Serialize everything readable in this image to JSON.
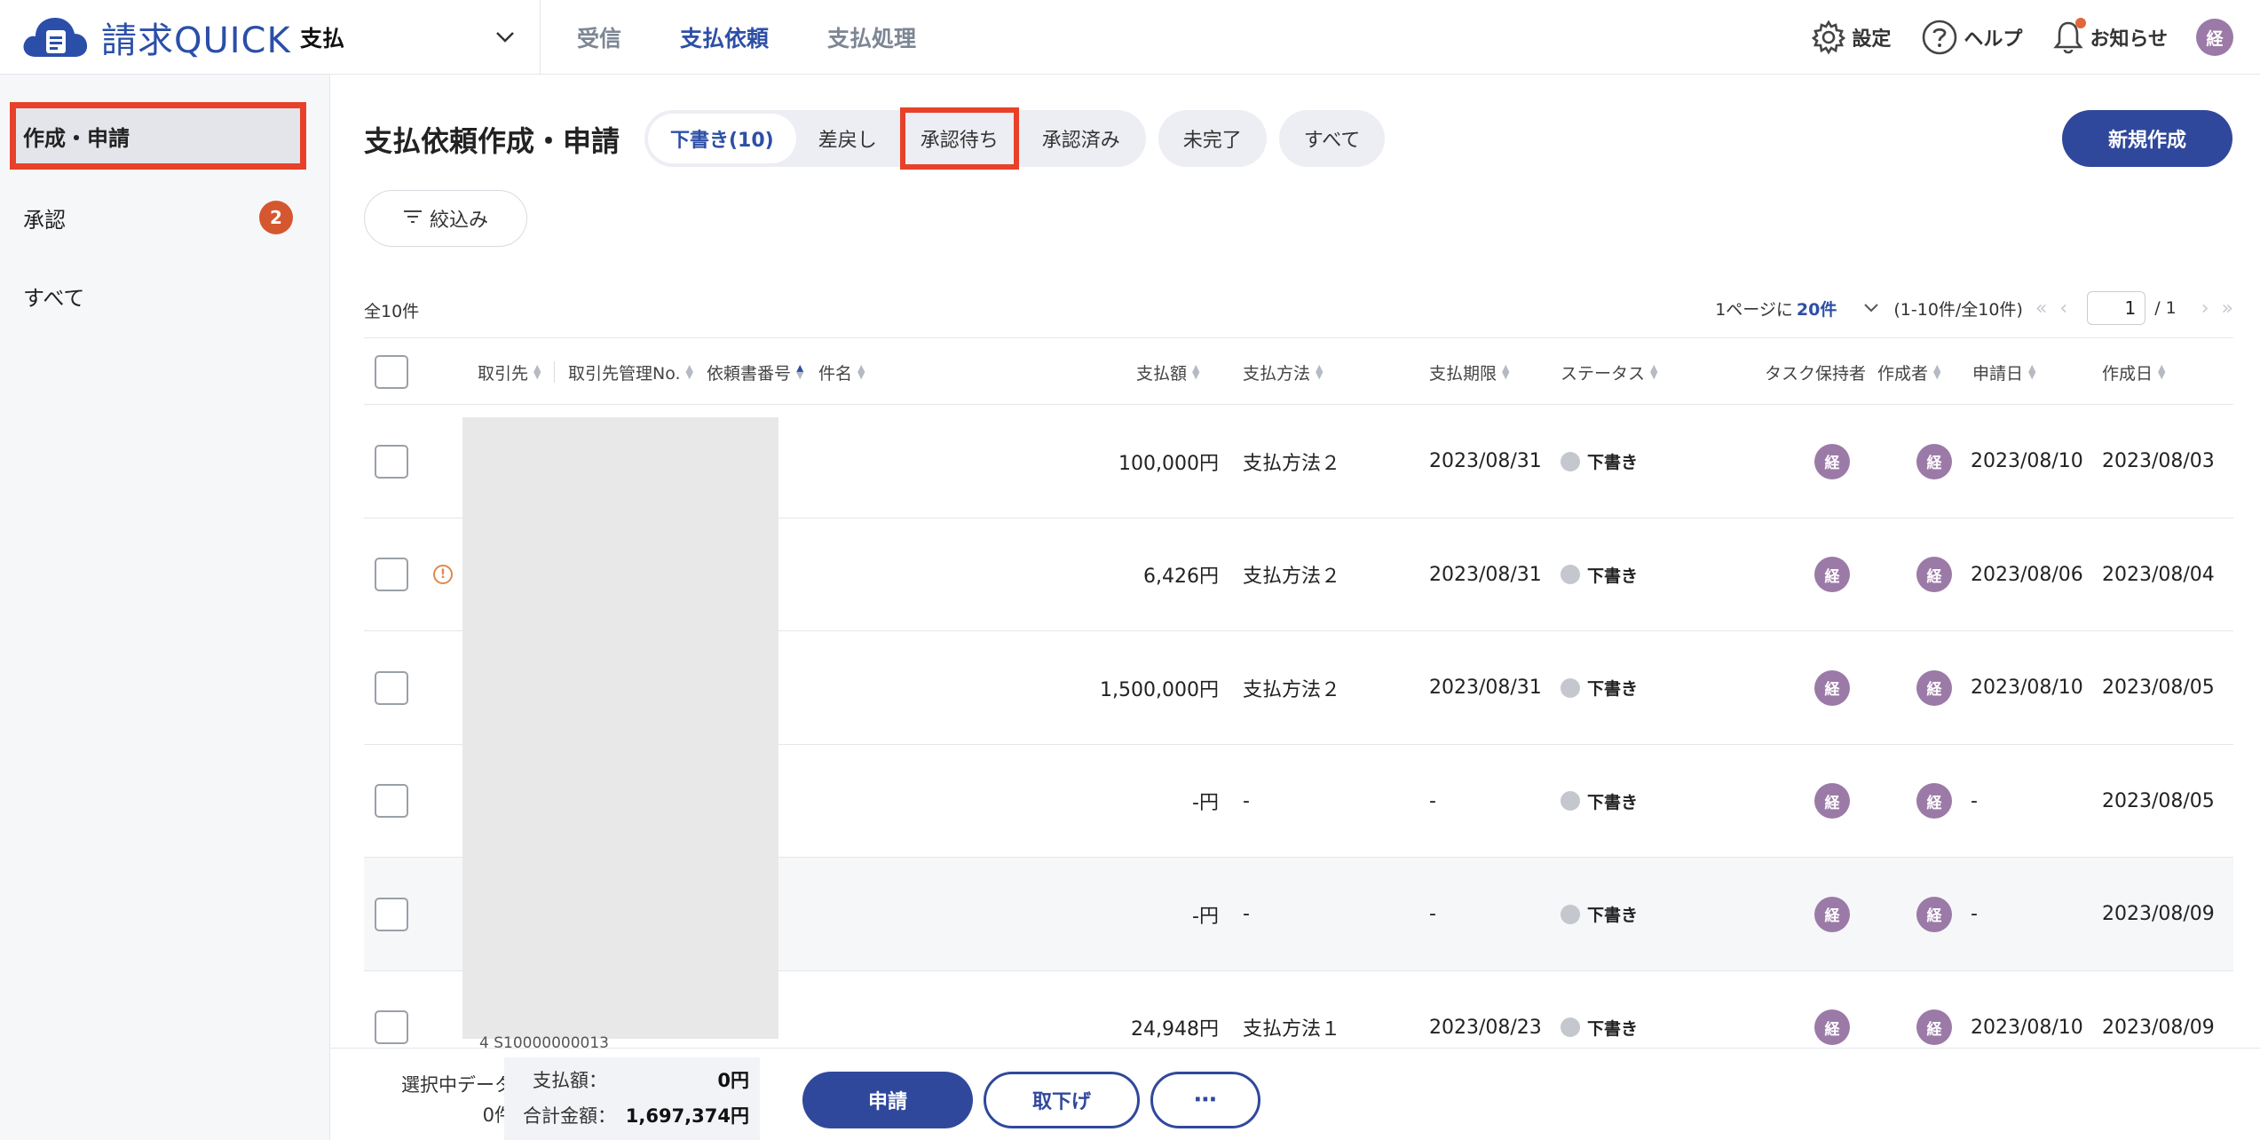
{
  "header": {
    "logo_text": "請求QUICK",
    "module": "支払",
    "nav": [
      "受信",
      "支払依頼",
      "支払処理"
    ],
    "active_nav": "支払依頼",
    "settings": "設定",
    "help": "ヘルプ",
    "notifications": "お知らせ",
    "avatar": "経",
    "accent": "#2d4fa6"
  },
  "sidebar": {
    "items": [
      {
        "label": "作成・申請"
      },
      {
        "label": "承認",
        "badge": "2"
      },
      {
        "label": "すべて"
      }
    ]
  },
  "main": {
    "title": "支払依頼作成・申請",
    "tabs": [
      "下書き(10)",
      "差戻し",
      "承認待ち",
      "承認済み",
      "未完了",
      "すべて"
    ],
    "new_button": "新規作成",
    "filter_button": "絞込み",
    "total": "全10件",
    "pager": {
      "per_page_prefix": "1ページに",
      "per_page": "20件",
      "range": "(1-10件/全10件)",
      "current_page": "1",
      "total_pages": "/ 1"
    },
    "columns": [
      "取引先",
      "取引先管理No.",
      "依頼書番号",
      "件名",
      "支払額",
      "支払方法",
      "支払期限",
      "ステータス",
      "タスク保持者",
      "作成者",
      "申請日",
      "作成日"
    ],
    "rows": [
      {
        "amount": "100,000円",
        "method": "支払方法２",
        "due": "2023/08/31",
        "status": "下書き",
        "task_holder": "経",
        "creator": "経",
        "applied": "2023/08/10",
        "created": "2023/08/03",
        "warning": false
      },
      {
        "amount": "6,426円",
        "method": "支払方法２",
        "due": "2023/08/31",
        "status": "下書き",
        "task_holder": "経",
        "creator": "経",
        "applied": "2023/08/06",
        "created": "2023/08/04",
        "warning": true
      },
      {
        "amount": "1,500,000円",
        "method": "支払方法２",
        "due": "2023/08/31",
        "status": "下書き",
        "task_holder": "経",
        "creator": "経",
        "applied": "2023/08/10",
        "created": "2023/08/05",
        "warning": false
      },
      {
        "amount": "-円",
        "method": "-",
        "due": "-",
        "status": "下書き",
        "task_holder": "経",
        "creator": "経",
        "applied": "-",
        "created": "2023/08/05",
        "warning": false
      },
      {
        "amount": "-円",
        "method": "-",
        "due": "-",
        "status": "下書き",
        "task_holder": "経",
        "creator": "経",
        "applied": "-",
        "created": "2023/08/09",
        "warning": false
      },
      {
        "amount": "24,948円",
        "method": "支払方法１",
        "due": "2023/08/23",
        "status": "下書き",
        "task_holder": "経",
        "creator": "経",
        "applied": "2023/08/10",
        "created": "2023/08/09",
        "warning": false
      }
    ],
    "peek_text": "4  S10000000013"
  },
  "footer": {
    "selected_label": "選択中データ",
    "selected_count": "0件",
    "payment_label": "支払額：",
    "payment_value": "0円",
    "total_label": "合計金額：",
    "total_value": "1,697,374円",
    "apply": "申請",
    "withdraw": "取下げ",
    "more": "⋯"
  }
}
